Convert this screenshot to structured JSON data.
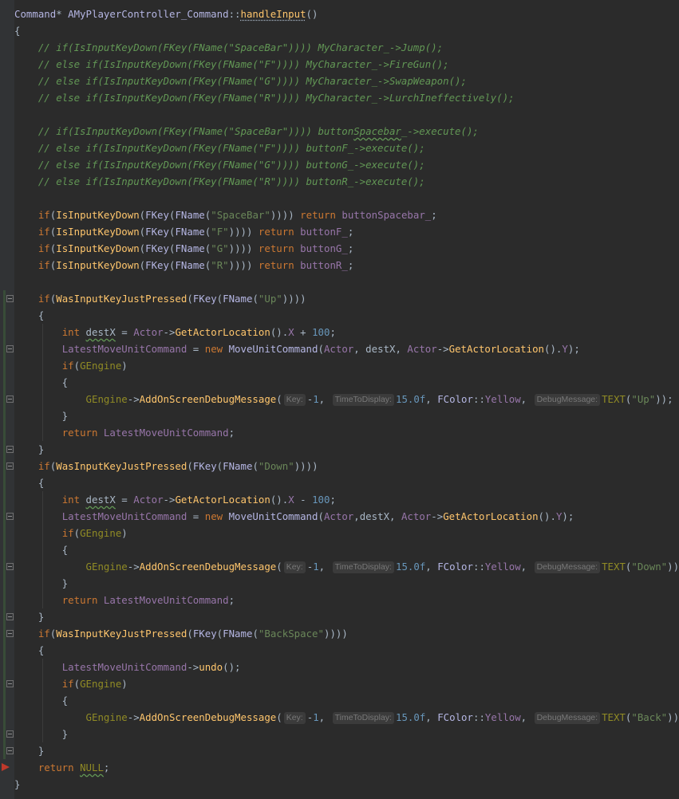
{
  "editor": {
    "lines": [
      [
        [
          "ty",
          "Command"
        ],
        [
          "nm",
          "* "
        ],
        [
          "ty",
          "AMyPlayerController_Command"
        ],
        [
          "nm",
          "::"
        ],
        [
          "fn",
          "handleInput",
          "dotted"
        ],
        [
          "nm",
          "()"
        ]
      ],
      [
        [
          "nm",
          "{"
        ]
      ],
      [
        [
          "nm",
          "    "
        ],
        [
          "cm",
          "// if(IsInputKeyDown(FKey(FName(\"SpaceBar\")))) MyCharacter_->Jump();"
        ]
      ],
      [
        [
          "nm",
          "    "
        ],
        [
          "cm",
          "// else if(IsInputKeyDown(FKey(FName(\"F\")))) MyCharacter_->FireGun();"
        ]
      ],
      [
        [
          "nm",
          "    "
        ],
        [
          "cm",
          "// else if(IsInputKeyDown(FKey(FName(\"G\")))) MyCharacter_->SwapWeapon();"
        ]
      ],
      [
        [
          "nm",
          "    "
        ],
        [
          "cm",
          "// else if(IsInputKeyDown(FKey(FName(\"R\")))) MyCharacter_->LurchIneffectively();"
        ]
      ],
      [],
      [
        [
          "nm",
          "    "
        ],
        [
          "cm",
          "// if(IsInputKeyDown(FKey(FName(\"SpaceBar\")))) button"
        ],
        [
          "cm",
          "Spacebar",
          "wavy"
        ],
        [
          "cm",
          "_->execute();"
        ]
      ],
      [
        [
          "nm",
          "    "
        ],
        [
          "cm",
          "// else if(IsInputKeyDown(FKey(FName(\"F\")))) buttonF_->execute();"
        ]
      ],
      [
        [
          "nm",
          "    "
        ],
        [
          "cm",
          "// else if(IsInputKeyDown(FKey(FName(\"G\")))) buttonG_->execute();"
        ]
      ],
      [
        [
          "nm",
          "    "
        ],
        [
          "cm",
          "// else if(IsInputKeyDown(FKey(FName(\"R\")))) buttonR_->execute();"
        ]
      ],
      [],
      [
        [
          "nm",
          "    "
        ],
        [
          "kw",
          "if"
        ],
        [
          "nm",
          "("
        ],
        [
          "fn",
          "IsInputKeyDown"
        ],
        [
          "nm",
          "("
        ],
        [
          "ty",
          "FKey"
        ],
        [
          "nm",
          "("
        ],
        [
          "ty",
          "FName"
        ],
        [
          "nm",
          "("
        ],
        [
          "str",
          "\"SpaceBar\""
        ],
        [
          "nm",
          "))))"
        ],
        [
          "kw",
          " return "
        ],
        [
          "mem",
          "buttonSpacebar_"
        ],
        [
          "nm",
          ";"
        ]
      ],
      [
        [
          "nm",
          "    "
        ],
        [
          "kw",
          "if"
        ],
        [
          "nm",
          "("
        ],
        [
          "fn",
          "IsInputKeyDown"
        ],
        [
          "nm",
          "("
        ],
        [
          "ty",
          "FKey"
        ],
        [
          "nm",
          "("
        ],
        [
          "ty",
          "FName"
        ],
        [
          "nm",
          "("
        ],
        [
          "str",
          "\"F\""
        ],
        [
          "nm",
          "))))"
        ],
        [
          "kw",
          " return "
        ],
        [
          "mem",
          "buttonF_"
        ],
        [
          "nm",
          ";"
        ]
      ],
      [
        [
          "nm",
          "    "
        ],
        [
          "kw",
          "if"
        ],
        [
          "nm",
          "("
        ],
        [
          "fn",
          "IsInputKeyDown"
        ],
        [
          "nm",
          "("
        ],
        [
          "ty",
          "FKey"
        ],
        [
          "nm",
          "("
        ],
        [
          "ty",
          "FName"
        ],
        [
          "nm",
          "("
        ],
        [
          "str",
          "\"G\""
        ],
        [
          "nm",
          "))))"
        ],
        [
          "kw",
          " return "
        ],
        [
          "mem",
          "buttonG_"
        ],
        [
          "nm",
          ";"
        ]
      ],
      [
        [
          "nm",
          "    "
        ],
        [
          "kw",
          "if"
        ],
        [
          "nm",
          "("
        ],
        [
          "fn",
          "IsInputKeyDown"
        ],
        [
          "nm",
          "("
        ],
        [
          "ty",
          "FKey"
        ],
        [
          "nm",
          "("
        ],
        [
          "ty",
          "FName"
        ],
        [
          "nm",
          "("
        ],
        [
          "str",
          "\"R\""
        ],
        [
          "nm",
          "))))"
        ],
        [
          "kw",
          " return "
        ],
        [
          "mem",
          "buttonR_"
        ],
        [
          "nm",
          ";"
        ]
      ],
      [],
      [
        [
          "nm",
          "    "
        ],
        [
          "kw",
          "if"
        ],
        [
          "nm",
          "("
        ],
        [
          "fn",
          "WasInputKeyJustPressed"
        ],
        [
          "nm",
          "("
        ],
        [
          "ty",
          "FKey"
        ],
        [
          "nm",
          "("
        ],
        [
          "ty",
          "FName"
        ],
        [
          "nm",
          "("
        ],
        [
          "str",
          "\"Up\""
        ],
        [
          "nm",
          "))))"
        ]
      ],
      [
        [
          "nm",
          "    {"
        ]
      ],
      [
        [
          "nm",
          "        "
        ],
        [
          "kw",
          "int "
        ],
        [
          "nm",
          "destX",
          "wavy"
        ],
        [
          "nm",
          " = "
        ],
        [
          "mem",
          "Actor"
        ],
        [
          "nm",
          "->"
        ],
        [
          "fn",
          "GetActorLocation"
        ],
        [
          "nm",
          "()."
        ],
        [
          "mem",
          "X"
        ],
        [
          "nm",
          " + "
        ],
        [
          "num",
          "100"
        ],
        [
          "nm",
          ";"
        ]
      ],
      [
        [
          "nm",
          "        "
        ],
        [
          "mem",
          "LatestMoveUnitCommand"
        ],
        [
          "nm",
          " = "
        ],
        [
          "kw",
          "new "
        ],
        [
          "ty",
          "MoveUnitCommand"
        ],
        [
          "nm",
          "("
        ],
        [
          "mem",
          "Actor"
        ],
        [
          "nm",
          ", destX, "
        ],
        [
          "mem",
          "Actor"
        ],
        [
          "nm",
          "->"
        ],
        [
          "fn",
          "GetActorLocation"
        ],
        [
          "nm",
          "()."
        ],
        [
          "mem",
          "Y"
        ],
        [
          "nm",
          ");"
        ]
      ],
      [
        [
          "nm",
          "        "
        ],
        [
          "kw",
          "if"
        ],
        [
          "nm",
          "("
        ],
        [
          "mac",
          "GEngine"
        ],
        [
          "nm",
          ")"
        ]
      ],
      [
        [
          "nm",
          "        {"
        ]
      ],
      [
        [
          "nm",
          "            "
        ],
        [
          "mac",
          "GEngine"
        ],
        [
          "nm",
          "->"
        ],
        [
          "fn",
          "AddOnScreenDebugMessage"
        ],
        [
          "nm",
          "("
        ],
        [
          "hint",
          "Key:"
        ],
        [
          "nm",
          "-"
        ],
        [
          "num",
          "1"
        ],
        [
          "nm",
          ", "
        ],
        [
          "hint",
          "TimeToDisplay:"
        ],
        [
          "num",
          "15.0f"
        ],
        [
          "nm",
          ", "
        ],
        [
          "ty",
          "FColor"
        ],
        [
          "nm",
          "::"
        ],
        [
          "mem",
          "Yellow"
        ],
        [
          "nm",
          ", "
        ],
        [
          "hint",
          "DebugMessage:"
        ],
        [
          "mac",
          "TEXT"
        ],
        [
          "nm",
          "("
        ],
        [
          "str",
          "\"Up\""
        ],
        [
          "nm",
          "));"
        ]
      ],
      [
        [
          "nm",
          "        }"
        ]
      ],
      [
        [
          "nm",
          "        "
        ],
        [
          "kw",
          "return "
        ],
        [
          "mem",
          "LatestMoveUnitCommand"
        ],
        [
          "nm",
          ";"
        ]
      ],
      [
        [
          "nm",
          "    }"
        ]
      ],
      [
        [
          "nm",
          "    "
        ],
        [
          "kw",
          "if"
        ],
        [
          "nm",
          "("
        ],
        [
          "fn",
          "WasInputKeyJustPressed"
        ],
        [
          "nm",
          "("
        ],
        [
          "ty",
          "FKey"
        ],
        [
          "nm",
          "("
        ],
        [
          "ty",
          "FName"
        ],
        [
          "nm",
          "("
        ],
        [
          "str",
          "\"Down\""
        ],
        [
          "nm",
          "))))"
        ]
      ],
      [
        [
          "nm",
          "    {"
        ]
      ],
      [
        [
          "nm",
          "        "
        ],
        [
          "kw",
          "int "
        ],
        [
          "nm",
          "destX",
          "wavy"
        ],
        [
          "nm",
          " = "
        ],
        [
          "mem",
          "Actor"
        ],
        [
          "nm",
          "->"
        ],
        [
          "fn",
          "GetActorLocation"
        ],
        [
          "nm",
          "()."
        ],
        [
          "mem",
          "X"
        ],
        [
          "nm",
          " - "
        ],
        [
          "num",
          "100"
        ],
        [
          "nm",
          ";"
        ]
      ],
      [
        [
          "nm",
          "        "
        ],
        [
          "mem",
          "LatestMoveUnitCommand"
        ],
        [
          "nm",
          " = "
        ],
        [
          "kw",
          "new "
        ],
        [
          "ty",
          "MoveUnitCommand"
        ],
        [
          "nm",
          "("
        ],
        [
          "mem",
          "Actor"
        ],
        [
          "nm",
          ",destX, "
        ],
        [
          "mem",
          "Actor"
        ],
        [
          "nm",
          "->"
        ],
        [
          "fn",
          "GetActorLocation"
        ],
        [
          "nm",
          "()."
        ],
        [
          "mem",
          "Y"
        ],
        [
          "nm",
          ");"
        ]
      ],
      [
        [
          "nm",
          "        "
        ],
        [
          "kw",
          "if"
        ],
        [
          "nm",
          "("
        ],
        [
          "mac",
          "GEngine"
        ],
        [
          "nm",
          ")"
        ]
      ],
      [
        [
          "nm",
          "        {"
        ]
      ],
      [
        [
          "nm",
          "            "
        ],
        [
          "mac",
          "GEngine"
        ],
        [
          "nm",
          "->"
        ],
        [
          "fn",
          "AddOnScreenDebugMessage"
        ],
        [
          "nm",
          "("
        ],
        [
          "hint",
          "Key:"
        ],
        [
          "nm",
          "-"
        ],
        [
          "num",
          "1"
        ],
        [
          "nm",
          ", "
        ],
        [
          "hint",
          "TimeToDisplay:"
        ],
        [
          "num",
          "15.0f"
        ],
        [
          "nm",
          ", "
        ],
        [
          "ty",
          "FColor"
        ],
        [
          "nm",
          "::"
        ],
        [
          "mem",
          "Yellow"
        ],
        [
          "nm",
          ", "
        ],
        [
          "hint",
          "DebugMessage:"
        ],
        [
          "mac",
          "TEXT"
        ],
        [
          "nm",
          "("
        ],
        [
          "str",
          "\"Down\""
        ],
        [
          "nm",
          "));"
        ]
      ],
      [
        [
          "nm",
          "        }"
        ]
      ],
      [
        [
          "nm",
          "        "
        ],
        [
          "kw",
          "return "
        ],
        [
          "mem",
          "LatestMoveUnitCommand"
        ],
        [
          "nm",
          ";"
        ]
      ],
      [
        [
          "nm",
          "    }"
        ]
      ],
      [
        [
          "nm",
          "    "
        ],
        [
          "kw",
          "if"
        ],
        [
          "nm",
          "("
        ],
        [
          "fn",
          "WasInputKeyJustPressed"
        ],
        [
          "nm",
          "("
        ],
        [
          "ty",
          "FKey"
        ],
        [
          "nm",
          "("
        ],
        [
          "ty",
          "FName"
        ],
        [
          "nm",
          "("
        ],
        [
          "str",
          "\"BackSpace\""
        ],
        [
          "nm",
          "))))"
        ]
      ],
      [
        [
          "nm",
          "    {"
        ]
      ],
      [
        [
          "nm",
          "        "
        ],
        [
          "mem",
          "LatestMoveUnitCommand"
        ],
        [
          "nm",
          "->"
        ],
        [
          "fn",
          "undo"
        ],
        [
          "nm",
          "();"
        ]
      ],
      [
        [
          "nm",
          "        "
        ],
        [
          "kw",
          "if"
        ],
        [
          "nm",
          "("
        ],
        [
          "mac",
          "GEngine"
        ],
        [
          "nm",
          ")"
        ]
      ],
      [
        [
          "nm",
          "        {"
        ]
      ],
      [
        [
          "nm",
          "            "
        ],
        [
          "mac",
          "GEngine"
        ],
        [
          "nm",
          "->"
        ],
        [
          "fn",
          "AddOnScreenDebugMessage"
        ],
        [
          "nm",
          "("
        ],
        [
          "hint",
          "Key:"
        ],
        [
          "nm",
          "-"
        ],
        [
          "num",
          "1"
        ],
        [
          "nm",
          ", "
        ],
        [
          "hint",
          "TimeToDisplay:"
        ],
        [
          "num",
          "15.0f"
        ],
        [
          "nm",
          ", "
        ],
        [
          "ty",
          "FColor"
        ],
        [
          "nm",
          "::"
        ],
        [
          "mem",
          "Yellow"
        ],
        [
          "nm",
          ", "
        ],
        [
          "hint",
          "DebugMessage:"
        ],
        [
          "mac",
          "TEXT"
        ],
        [
          "nm",
          "("
        ],
        [
          "str",
          "\"Back\""
        ],
        [
          "nm",
          "));"
        ]
      ],
      [
        [
          "nm",
          "        }"
        ]
      ],
      [
        [
          "nm",
          "    }"
        ]
      ],
      [
        [
          "nm",
          "    "
        ],
        [
          "kw",
          "return "
        ],
        [
          "mac",
          "NULL",
          "wavy"
        ],
        [
          "nm",
          ";"
        ]
      ],
      [
        [
          "nm",
          "}"
        ]
      ]
    ],
    "fold_lines": [
      17,
      20,
      23,
      26,
      27,
      30,
      33,
      36,
      37,
      40,
      43,
      44
    ],
    "breakpoint_line": 45,
    "colors": {
      "background": "#2b2b2b",
      "gutter": "#313335",
      "keyword": "#cc7832",
      "comment": "#629755",
      "string": "#6a8759",
      "number": "#6897bb",
      "function": "#ffc66d",
      "type": "#b5b6e3",
      "member": "#9876aa",
      "macro": "#908b25"
    }
  }
}
